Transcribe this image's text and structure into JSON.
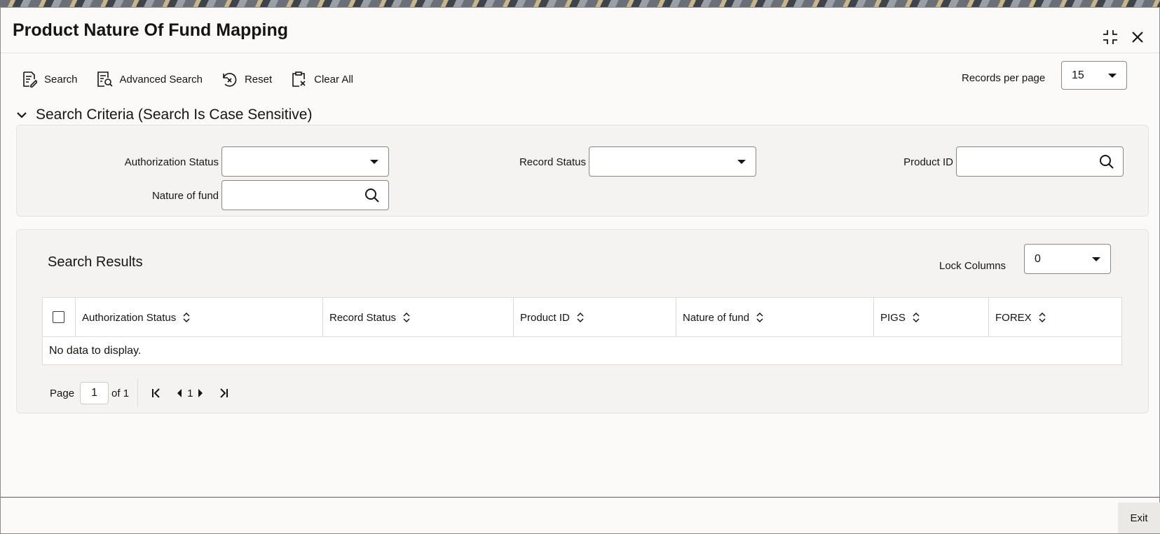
{
  "window": {
    "title": "Product Nature Of Fund Mapping",
    "maximize_icon": "collapse-arrows-icon",
    "close_icon": "close-icon"
  },
  "toolbar": {
    "search_label": "Search",
    "advanced_search_label": "Advanced Search",
    "reset_label": "Reset",
    "clear_all_label": "Clear All",
    "records_per_page_label": "Records per page",
    "records_per_page_value": "15"
  },
  "search_criteria": {
    "heading": "Search Criteria (Search Is Case Sensitive)",
    "authorization_status_label": "Authorization Status",
    "authorization_status_value": "",
    "record_status_label": "Record Status",
    "record_status_value": "",
    "product_id_label": "Product ID",
    "product_id_value": "",
    "nature_of_fund_label": "Nature of fund",
    "nature_of_fund_value": ""
  },
  "results": {
    "heading": "Search Results",
    "lock_columns_label": "Lock Columns",
    "lock_columns_value": "0",
    "columns": [
      "Authorization Status",
      "Record Status",
      "Product ID",
      "Nature of fund",
      "PIGS",
      "FOREX"
    ],
    "empty_message": "No data to display."
  },
  "pager": {
    "page_label": "Page",
    "page_value": "1",
    "of_label": "of 1",
    "current_page": "1"
  },
  "footer": {
    "exit_label": "Exit"
  }
}
